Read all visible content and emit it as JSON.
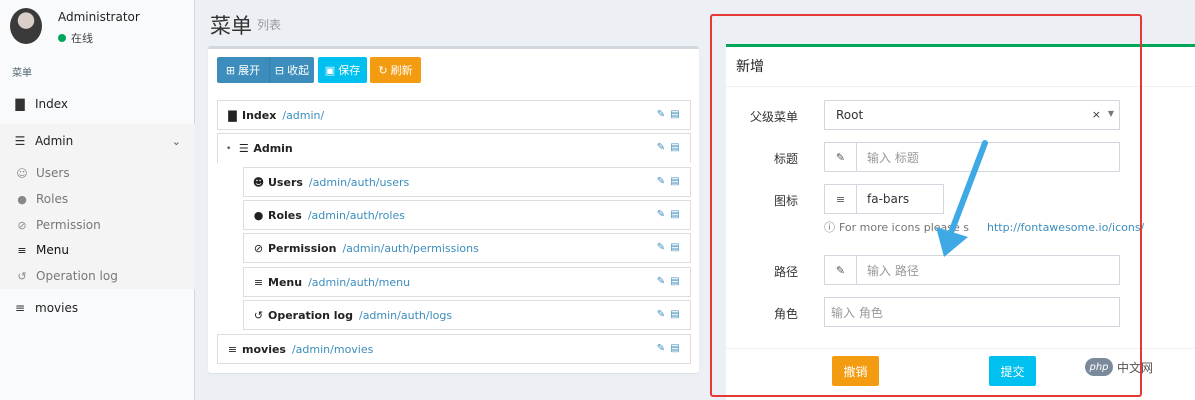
{
  "user": {
    "name": "Administrator",
    "status": "在线"
  },
  "sidebar": {
    "header": "菜单",
    "items": [
      {
        "label": "Index",
        "icon": "bar-chart-icon"
      },
      {
        "label": "Admin",
        "icon": "tasks-icon"
      },
      {
        "label": "movies",
        "icon": "bars-icon"
      }
    ],
    "subitems": [
      {
        "label": "Users",
        "icon": "users-icon"
      },
      {
        "label": "Roles",
        "icon": "user-icon"
      },
      {
        "label": "Permission",
        "icon": "ban-icon"
      },
      {
        "label": "Menu",
        "icon": "bars-icon"
      },
      {
        "label": "Operation log",
        "icon": "history-icon"
      }
    ]
  },
  "page": {
    "title": "菜单",
    "subtitle": "列表"
  },
  "toolbar": {
    "expand": "展开",
    "collapse": "收起",
    "save": "保存",
    "refresh": "刷新"
  },
  "tree": [
    {
      "title": "Index",
      "uri": "/admin/",
      "icon": "bar-chart-icon"
    },
    {
      "title": "Admin",
      "uri": "",
      "icon": "tasks-icon"
    },
    {
      "title": "Users",
      "uri": "/admin/auth/users",
      "icon": "users-icon"
    },
    {
      "title": "Roles",
      "uri": "/admin/auth/roles",
      "icon": "user-icon"
    },
    {
      "title": "Permission",
      "uri": "/admin/auth/permissions",
      "icon": "ban-icon"
    },
    {
      "title": "Menu",
      "uri": "/admin/auth/menu",
      "icon": "bars-icon"
    },
    {
      "title": "Operation log",
      "uri": "/admin/auth/logs",
      "icon": "history-icon"
    },
    {
      "title": "movies",
      "uri": "/admin/movies",
      "icon": "bars-icon"
    }
  ],
  "form": {
    "title": "新增",
    "parent_label": "父级菜单",
    "parent_value": "Root",
    "title_label": "标题",
    "title_placeholder": "输入 标题",
    "icon_label": "图标",
    "icon_value": "fa-bars",
    "help_text": "For more icons please s",
    "help_link": "http://fontawesome.io/icons/",
    "path_label": "路径",
    "path_placeholder": "输入 路径",
    "role_label": "角色",
    "role_placeholder": "输入 角色",
    "reset": "撤销",
    "submit": "提交"
  },
  "watermark": {
    "logo": "php",
    "text": "中文网"
  },
  "colors": {
    "primary": "#3c8dbc",
    "info": "#00c0ef",
    "warning": "#f39c12",
    "success": "#00a65a",
    "annotation": "#e53935"
  }
}
